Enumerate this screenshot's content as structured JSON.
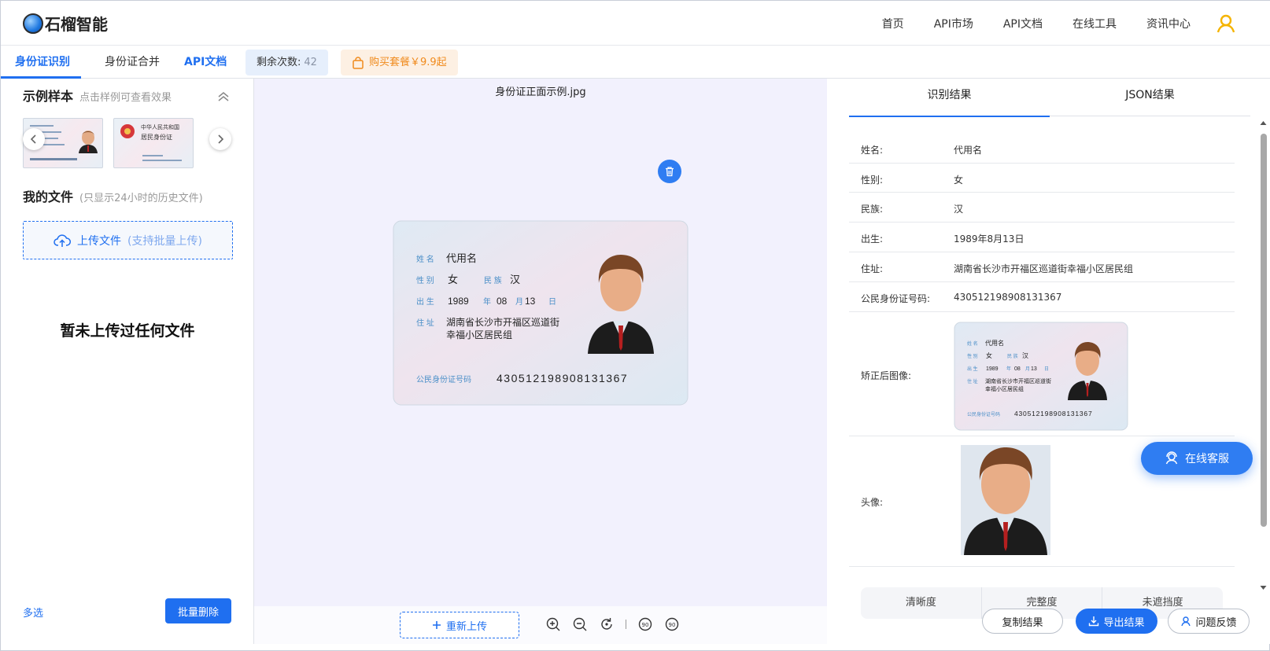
{
  "header": {
    "logo_text": "石榴智能",
    "nav": [
      "首页",
      "API市场",
      "API文档",
      "在线工具",
      "资讯中心"
    ]
  },
  "tabbar": {
    "tab_id": "身份证识别",
    "tab_merge": "身份证合并",
    "tab_api": "API文档",
    "remaining_label": "剩余次数:",
    "remaining_count": "42",
    "buy_label": "购买套餐￥9.9起"
  },
  "left": {
    "samples_title": "示例样本",
    "samples_hint": "点击样例可查看效果",
    "files_title": "我的文件",
    "files_hint": "(只显示24小时的历史文件)",
    "upload_label": "上传文件",
    "upload_hint": "(支持批量上传)",
    "empty_text": "暂未上传过任何文件",
    "multi_select": "多选",
    "batch_delete": "批量删除"
  },
  "card": {
    "name_label": "姓 名",
    "name": "代用名",
    "gender_label": "性 别",
    "gender": "女",
    "ethnic_label": "民 族",
    "ethnic": "汉",
    "birth_label": "出 生",
    "birth_year": "1989",
    "year": "年",
    "birth_month": "08",
    "month": "月",
    "birth_day": "13",
    "day": "日",
    "addr_label": "住 址",
    "addr1": "湖南省长沙市开福区巡道街",
    "addr2": "幸福小区居民组",
    "id_label": "公民身份证号码",
    "id_number": "430512198908131367",
    "back_line1": "中华人民共和国",
    "back_line2": "居民身份证"
  },
  "center": {
    "filename": "身份证正面示例.jpg",
    "reupload": "重新上传",
    "tools": [
      "zoom-in-icon",
      "zoom-out-icon",
      "rotate-icon",
      "rotate-left-90-icon",
      "rotate-right-90-icon"
    ],
    "rotate_left_text": "90",
    "rotate_right_text": "90"
  },
  "right": {
    "tab_result": "识别结果",
    "tab_json": "JSON结果",
    "fields": [
      {
        "k": "姓名:",
        "v": "代用名"
      },
      {
        "k": "性别:",
        "v": "女"
      },
      {
        "k": "民族:",
        "v": "汉"
      },
      {
        "k": "出生:",
        "v": "1989年8月13日"
      },
      {
        "k": "住址:",
        "v": "湖南省长沙市开福区巡道街幸福小区居民组"
      },
      {
        "k": "公民身份证号码:",
        "v": "430512198908131367"
      }
    ],
    "corrected_label": "矫正后图像:",
    "avatar_label": "头像:",
    "quality": [
      "清晰度",
      "完整度",
      "未遮挡度"
    ],
    "copy": "复制结果",
    "export": "导出结果",
    "feedback": "问题反馈"
  },
  "service": "在线客服",
  "colors": {
    "accent": "#1f6ff0",
    "orange": "#f08a1c",
    "center_bg": "#f2f1fd"
  }
}
